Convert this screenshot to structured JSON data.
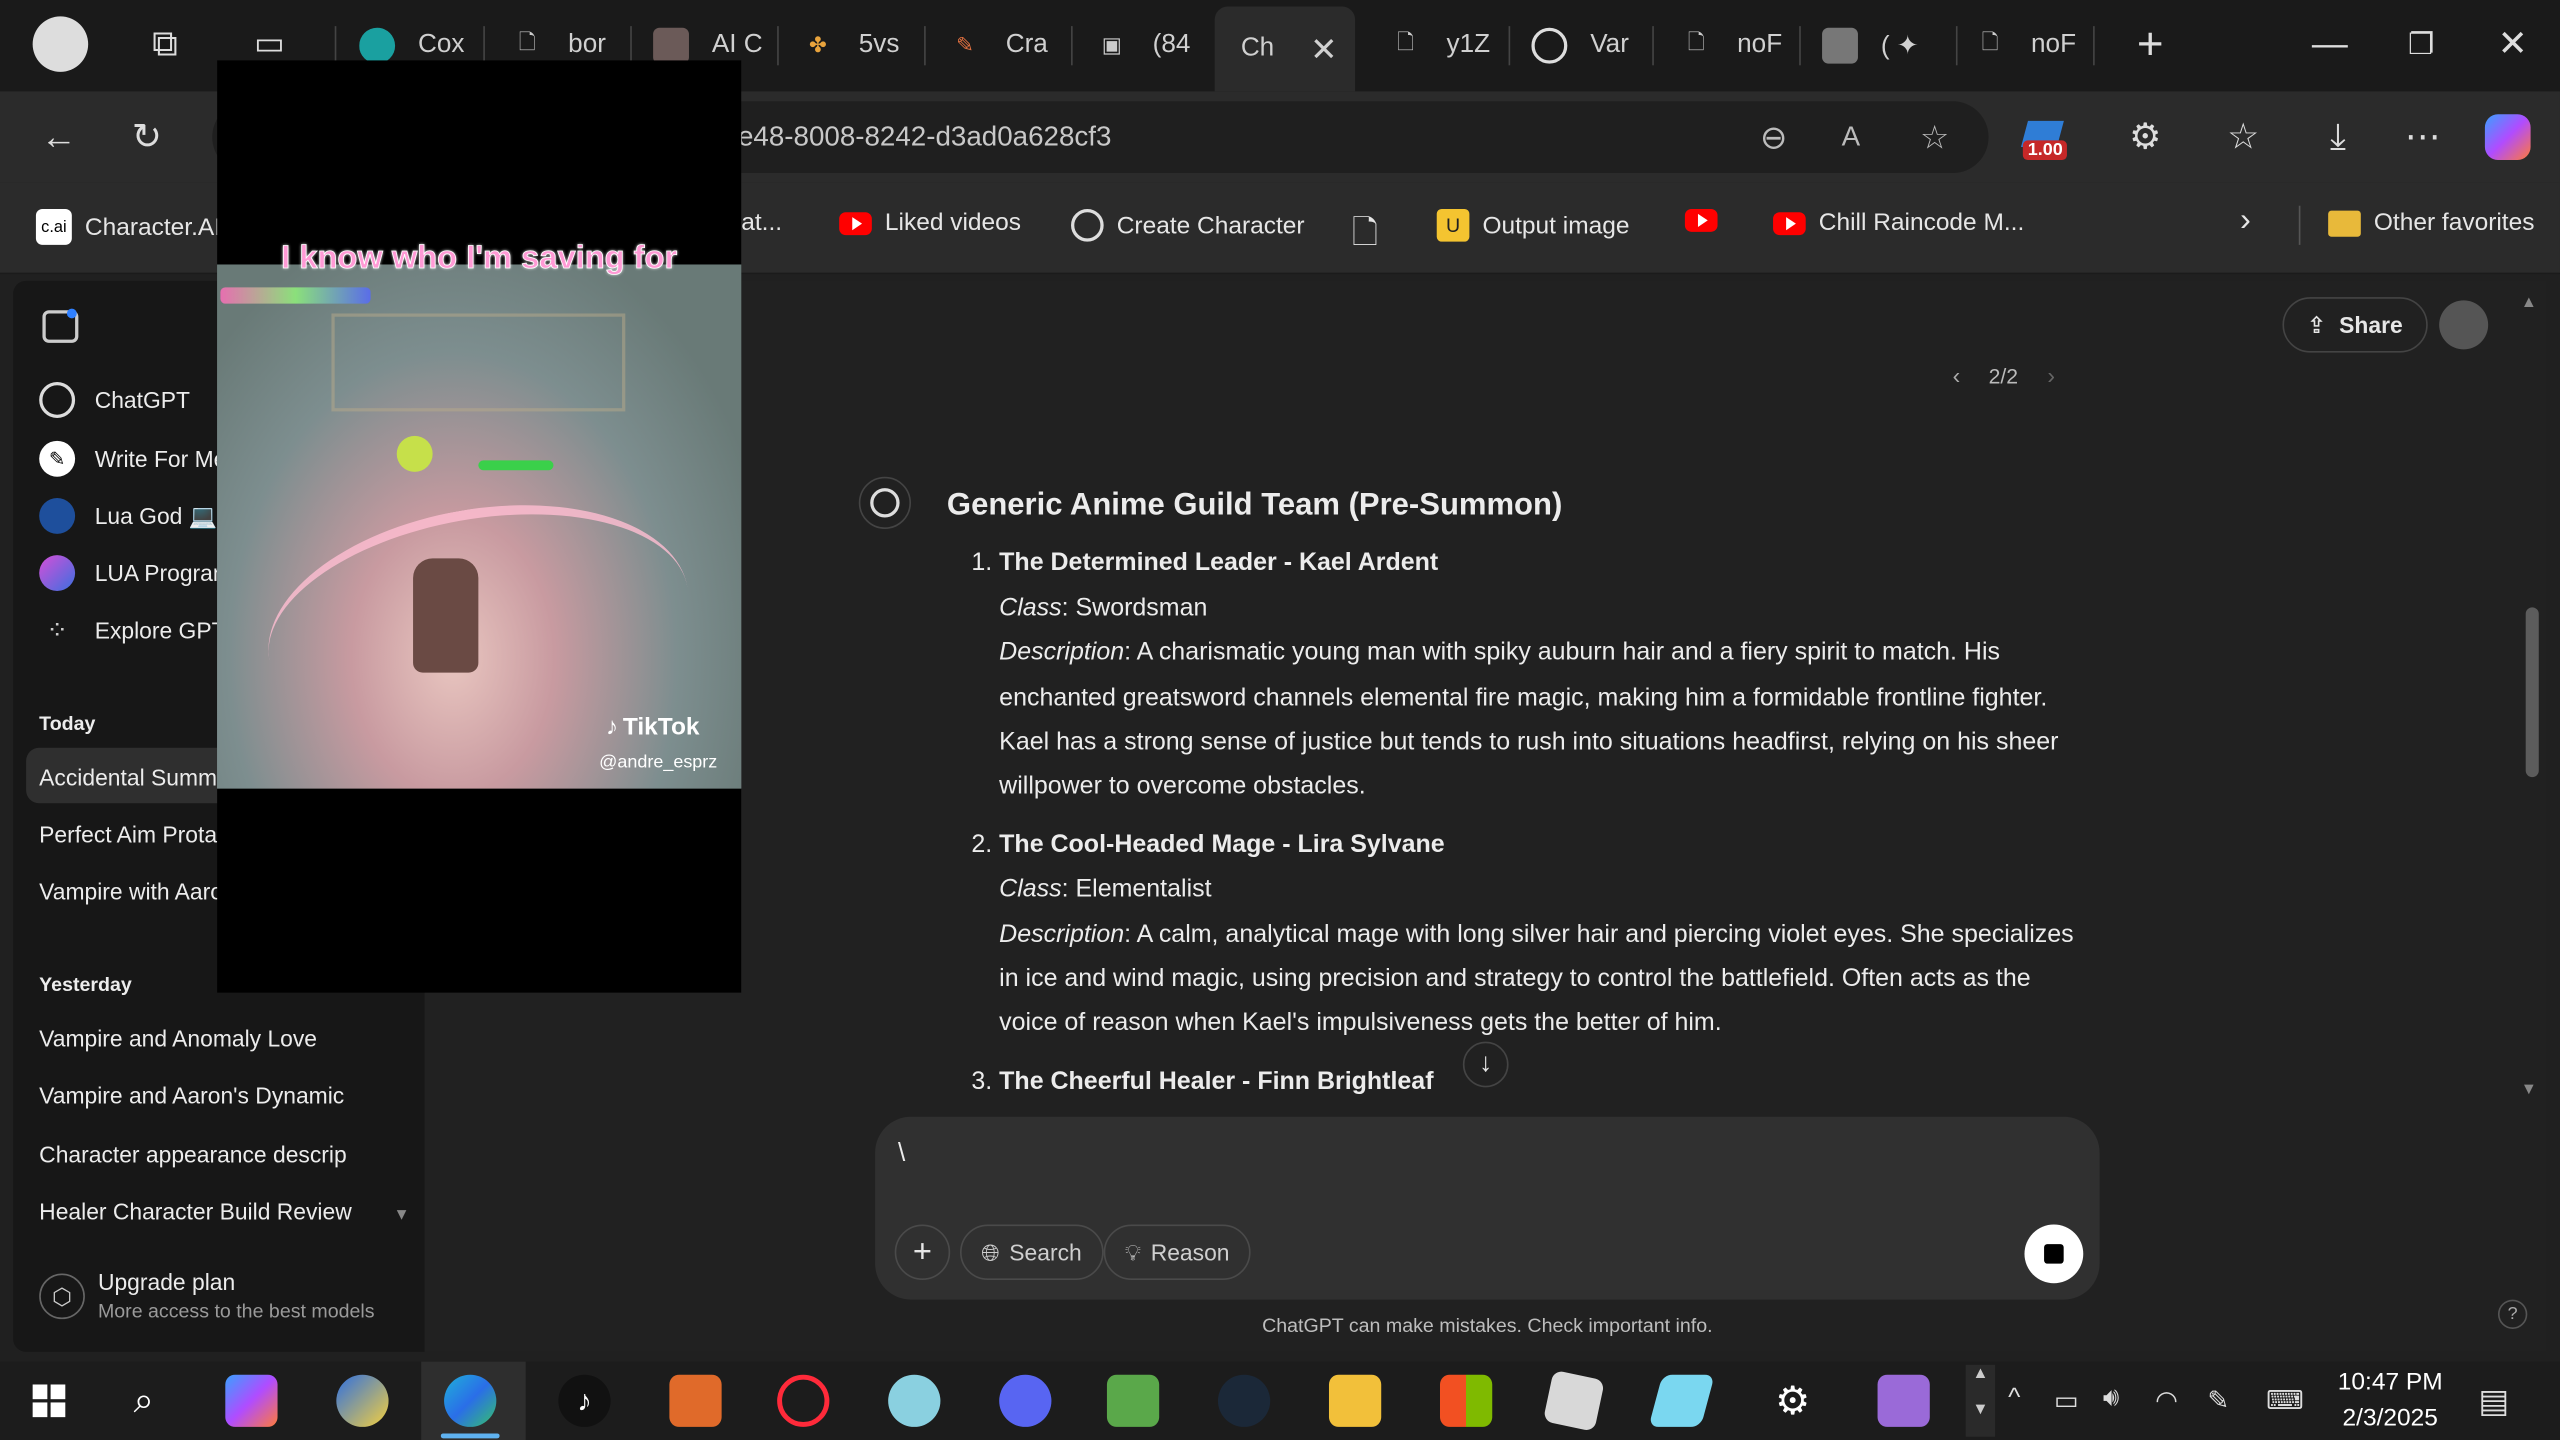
{
  "browser": {
    "tabs": [
      {
        "label": "Cox"
      },
      {
        "label": "bor"
      },
      {
        "label": "AI C"
      },
      {
        "label": "5vs"
      },
      {
        "label": "Cra"
      },
      {
        "label": "(84"
      },
      {
        "label": "Ch"
      },
      {
        "label": "y1Z"
      },
      {
        "label": "Var"
      },
      {
        "label": "noF"
      },
      {
        "label": "( ✦"
      },
      {
        "label": "noF"
      }
    ],
    "url": "e48-8008-8242-d3ad0a628cf3",
    "badge": "1.00",
    "favorites": [
      {
        "label": "Character.AI"
      },
      {
        "label": "at..."
      },
      {
        "label": "Liked videos"
      },
      {
        "label": "Create Character"
      },
      {
        "label": "Output image"
      },
      {
        "label": "Chill Raincode M..."
      },
      {
        "label": "Other favorites"
      }
    ]
  },
  "sidebar": {
    "items": [
      {
        "label": "ChatGPT"
      },
      {
        "label": "Write For Me"
      },
      {
        "label": "Lua God 💻"
      },
      {
        "label": "LUA Program"
      },
      {
        "label": "Explore GPTs"
      }
    ],
    "today_label": "Today",
    "today": [
      "Accidental Summo",
      "Perfect Aim Protag",
      "Vampire with Aaro"
    ],
    "yesterday_label": "Yesterday",
    "yesterday": [
      "Vampire and Anomaly Love",
      "Vampire and Aaron's Dynamic",
      "Character appearance descrip",
      "Healer Character Build Review"
    ],
    "upgrade_title": "Upgrade plan",
    "upgrade_sub": "More access to the best models"
  },
  "header": {
    "share": "Share",
    "pager": "2/2"
  },
  "message": {
    "title": "Generic Anime Guild Team (Pre-Summon)",
    "items": [
      {
        "name": "The Determined Leader - Kael Ardent",
        "class_label": "Class",
        "class_value": ": Swordsman",
        "desc_label": "Description",
        "desc_value": ": A charismatic young man with spiky auburn hair and a fiery spirit to match. His enchanted greatsword channels elemental fire magic, making him a formidable frontline fighter. Kael has a strong sense of justice but tends to rush into situations headfirst, relying on his sheer willpower to overcome obstacles."
      },
      {
        "name": "The Cool-Headed Mage - Lira Sylvane",
        "class_label": "Class",
        "class_value": ": Elementalist",
        "desc_label": "Description",
        "desc_value": ": A calm, analytical mage with long silver hair and piercing violet eyes. She specializes in ice and wind magic, using precision and strategy to control the battlefield. Often acts as the voice of reason when Kael's impulsiveness gets the better of him."
      },
      {
        "name": "The Cheerful Healer - Finn Brightleaf"
      }
    ]
  },
  "composer": {
    "value": "\\",
    "search": "Search",
    "reason": "Reason"
  },
  "disclaimer": "ChatGPT can make mistakes. Check important info.",
  "video": {
    "caption": "I know who I'm saving for",
    "brand": "TikTok",
    "handle": "@andre_esprz"
  },
  "taskbar": {
    "time": "10:47 PM",
    "date": "2/3/2025"
  },
  "colors": {
    "accent": "#ffffff",
    "youtube": "#ff0000",
    "caption_pink": "#ff9ad5"
  }
}
